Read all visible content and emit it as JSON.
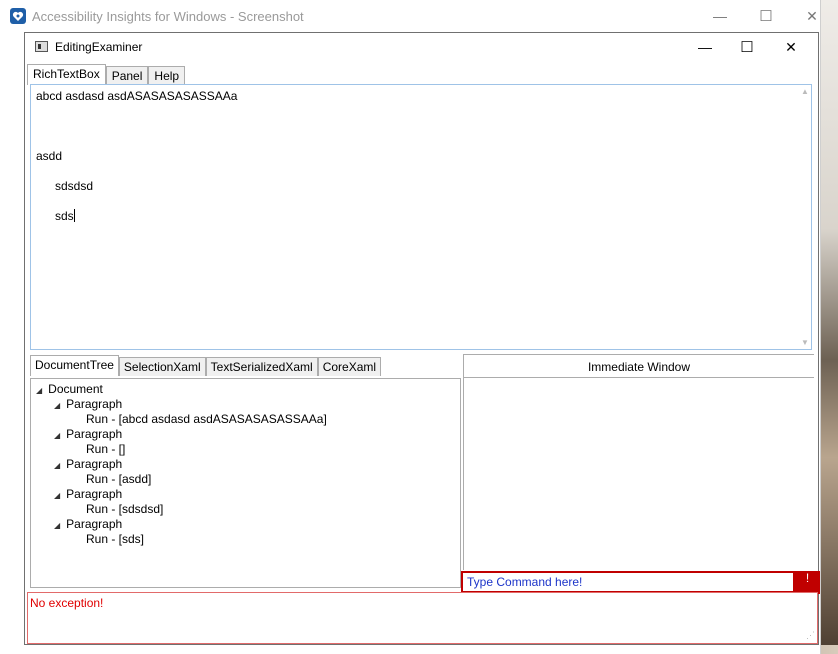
{
  "outer_window": {
    "title": "Accessibility Insights for Windows - Screenshot",
    "controls": {
      "minimize": "—",
      "maximize": "☐",
      "close": "✕"
    }
  },
  "app_window": {
    "title": "EditingExaminer",
    "controls": {
      "minimize": "—",
      "maximize": "☐",
      "close": "✕"
    }
  },
  "top_tabs": [
    {
      "label": "RichTextBox",
      "selected": true
    },
    {
      "label": "Panel",
      "selected": false
    },
    {
      "label": "Help",
      "selected": false
    }
  ],
  "rich_text": {
    "lines": [
      "abcd asdasd asdASASASASASSAAa",
      "asdd",
      "sdsdsd",
      "sds"
    ]
  },
  "bottom_tabs": [
    {
      "label": "DocumentTree",
      "selected": true
    },
    {
      "label": "SelectionXaml",
      "selected": false
    },
    {
      "label": "TextSerializedXaml",
      "selected": false
    },
    {
      "label": "CoreXaml",
      "selected": false
    }
  ],
  "document_tree": {
    "root": "Document",
    "paragraph_label": "Paragraph",
    "runs": [
      "Run - [abcd asdasd asdASASASASASSAAa]",
      "Run - []",
      "Run - [asdd]",
      "Run - [sdsdsd]",
      "Run - [sds]"
    ]
  },
  "immediate_window": {
    "header": "Immediate Window",
    "command_placeholder": "Type Command here!",
    "error_indicator": "!"
  },
  "exception_panel": {
    "text": "No exception!"
  },
  "colors": {
    "error": "#c00000",
    "command_text": "#1d35c9",
    "exception_text": "#e00000"
  }
}
